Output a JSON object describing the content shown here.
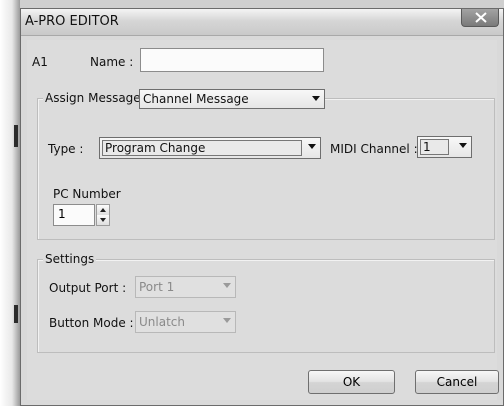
{
  "window": {
    "title": "A-PRO EDITOR"
  },
  "name_row": {
    "button_id": "A1",
    "name_label": "Name :",
    "name_value": ""
  },
  "assign_message": {
    "label": "Assign Message :",
    "selected": "Channel Message",
    "type_label": "Type :",
    "type_selected": "Program Change",
    "midi_channel_label": "MIDI Channel :",
    "midi_channel_selected": "1",
    "pc_number_label": "PC Number",
    "pc_number_value": "1"
  },
  "settings": {
    "group_title": "Settings",
    "output_port_label": "Output Port :",
    "output_port_selected": "Port 1",
    "button_mode_label": "Button Mode :",
    "button_mode_selected": "Unlatch"
  },
  "buttons": {
    "ok": "OK",
    "cancel": "Cancel"
  },
  "icons": {
    "close": "close-icon",
    "dropdown": "chevron-down-icon",
    "spin_up": "spin-up-icon",
    "spin_down": "spin-down-icon"
  }
}
